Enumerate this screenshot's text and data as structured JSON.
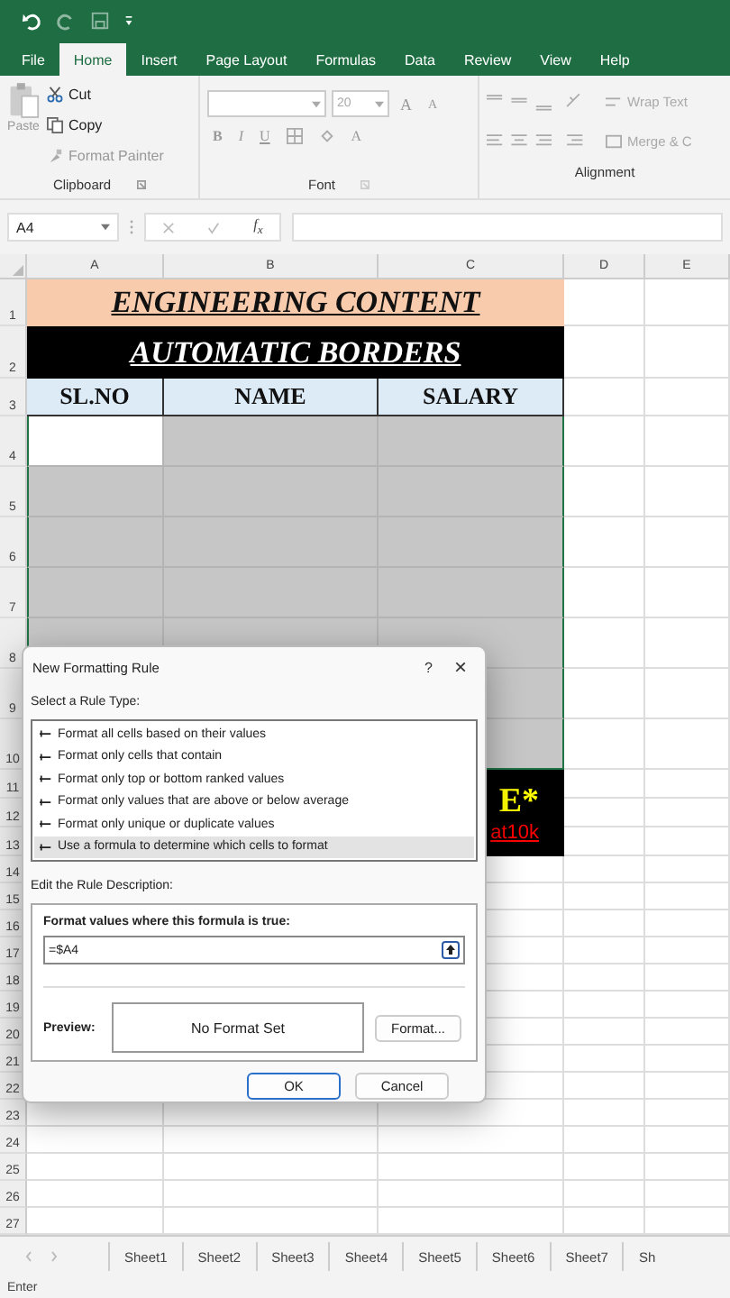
{
  "ribbon_tabs": [
    {
      "label": "File",
      "selected": false
    },
    {
      "label": "Home",
      "selected": true
    },
    {
      "label": "Insert",
      "selected": false
    },
    {
      "label": "Page Layout",
      "selected": false
    },
    {
      "label": "Formulas",
      "selected": false
    },
    {
      "label": "Data",
      "selected": false
    },
    {
      "label": "Review",
      "selected": false
    },
    {
      "label": "View",
      "selected": false
    },
    {
      "label": "Help",
      "selected": false
    }
  ],
  "clipboard": {
    "paste": "Paste",
    "cut": "Cut",
    "copy": "Copy",
    "format_painter": "Format Painter",
    "label": "Clipboard"
  },
  "font": {
    "size": "20",
    "bold": "B",
    "italic": "I",
    "underline": "U",
    "font_color": "A",
    "grow": "A",
    "shrink": "A",
    "label": "Font"
  },
  "alignment": {
    "wrap_text": "Wrap Text",
    "merge": "Merge & C",
    "label": "Alignment"
  },
  "formula_bar": {
    "name_box": "A4",
    "function": "f$_{x}$"
  },
  "sheet": {
    "columns": [
      "A",
      "B",
      "C",
      "D",
      "E"
    ],
    "rows": [
      "1",
      "2",
      "3",
      "4",
      "5",
      "6",
      "7",
      "8",
      "9",
      "10",
      "11",
      "12",
      "13",
      "14",
      "15",
      "16",
      "17",
      "18",
      "19",
      "20",
      "21",
      "22",
      "23",
      "24",
      "25",
      "26",
      "27"
    ],
    "title": "ENGINEERING CONTENT",
    "subtitle": "AUTOMATIC BORDERS",
    "headers": [
      "SL.NO",
      "NAME",
      "SALARY"
    ],
    "note_lines": [
      "E*",
      "at10k"
    ]
  },
  "dialog": {
    "title": "New Formatting Rule",
    "help": "?",
    "close": "×",
    "rule_type_label": "Select a Rule Type:",
    "rule_types": [
      {
        "label": "Format all cells based on their values",
        "selected": false
      },
      {
        "label": "Format only cells that contain",
        "selected": false
      },
      {
        "label": "Format only top or bottom ranked values",
        "selected": false
      },
      {
        "label": "Format only values that are above or below average",
        "selected": false
      },
      {
        "label": "Format only unique or duplicate values",
        "selected": false
      },
      {
        "label": "Use a formula to determine which cells to format",
        "selected": true
      }
    ],
    "description_label": "Edit the Rule Description:",
    "formula_label": "Format values where this formula is true:",
    "formula": "=$A4",
    "preview_label": "Preview:",
    "preview": "No Format Set",
    "format_button": "Format...",
    "ok": "OK",
    "cancel": "Cancel"
  },
  "sheet_tabs": [
    {
      "label": "Sheet1",
      "selected": false
    },
    {
      "label": "Sheet2",
      "selected": false
    },
    {
      "label": "Sheet3",
      "selected": false
    },
    {
      "label": "Sheet4",
      "selected": false
    },
    {
      "label": "Sheet5",
      "selected": false
    },
    {
      "label": "Sheet6",
      "selected": false
    },
    {
      "label": "Sheet7",
      "selected": false
    },
    {
      "label": "Sh",
      "selected": false
    }
  ],
  "status_bar": "Enter"
}
